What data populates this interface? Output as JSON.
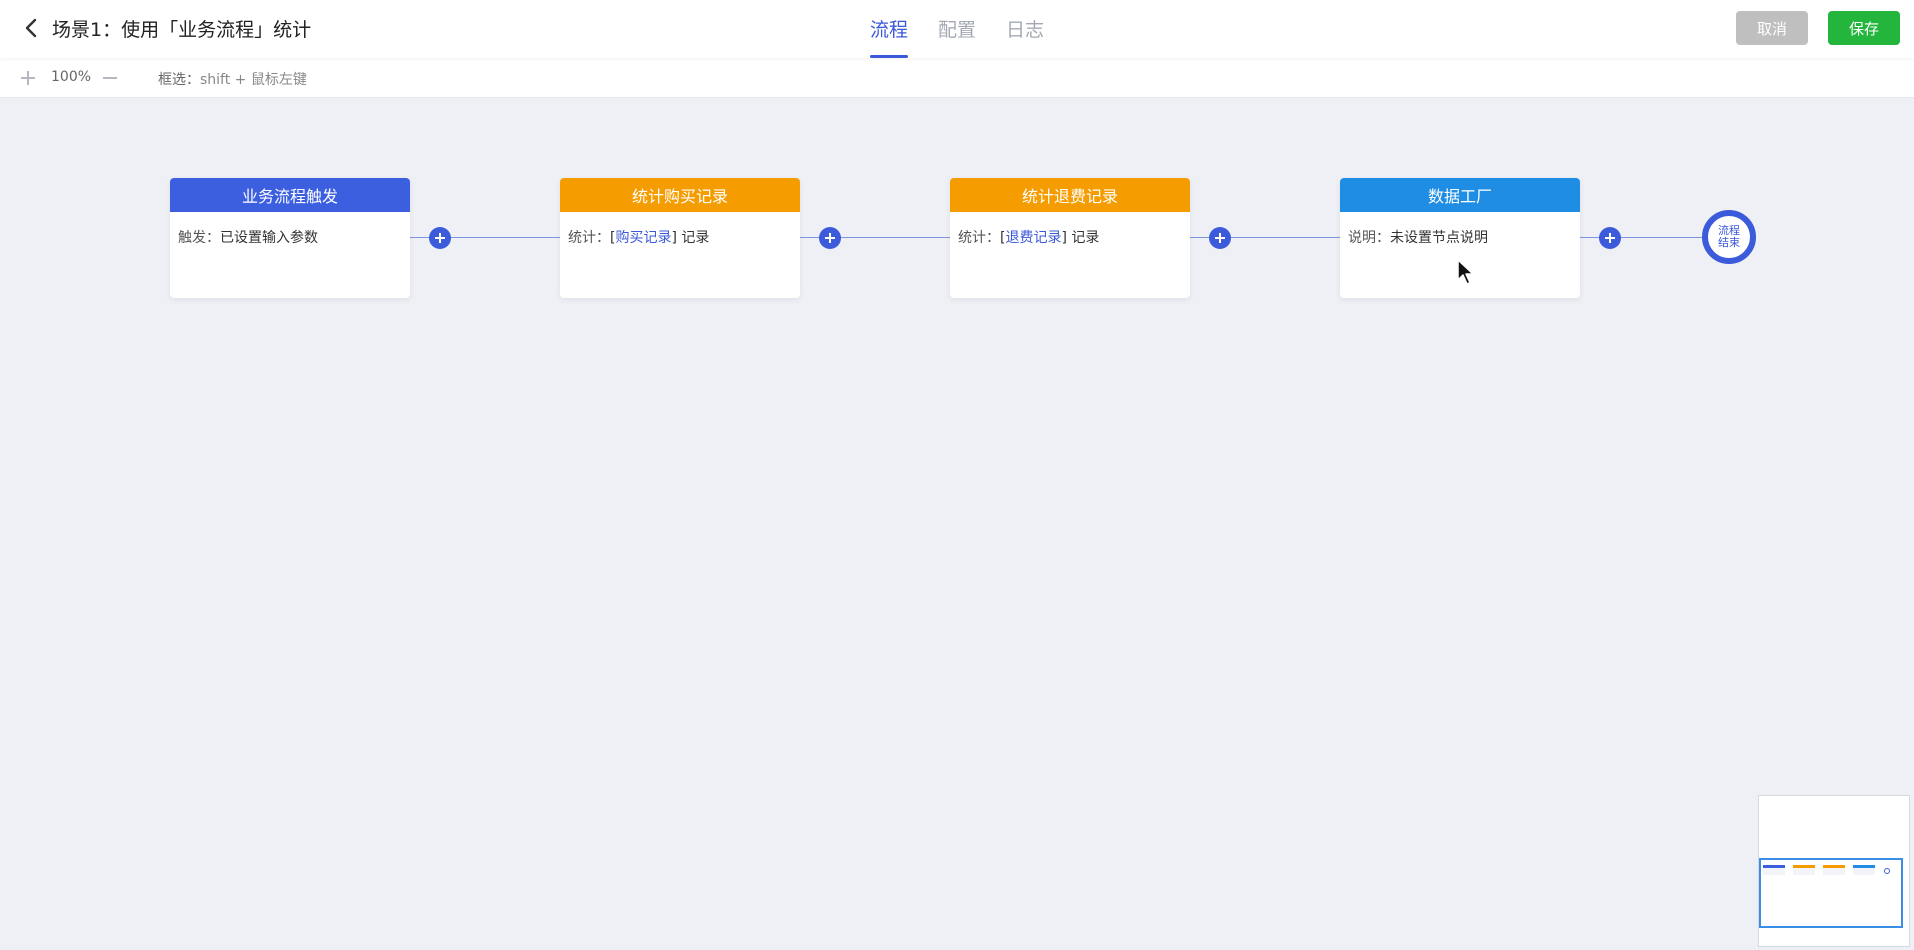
{
  "header": {
    "title": "场景1：使用「业务流程」统计",
    "tabs": [
      {
        "label": "流程",
        "active": true
      },
      {
        "label": "配置",
        "active": false
      },
      {
        "label": "日志",
        "active": false
      }
    ],
    "cancel_label": "取消",
    "save_label": "保存"
  },
  "toolbar": {
    "zoom_level": "100%",
    "select_hint_label": "框选：",
    "select_hint_keys": "shift + 鼠标左键"
  },
  "flow": {
    "nodes": [
      {
        "title": "业务流程触发",
        "color": "#3c5fe0",
        "label": "触发：",
        "before": "",
        "link": "",
        "after": "已设置输入参数"
      },
      {
        "title": "统计购买记录",
        "color": "#f59c00",
        "label": "统计：",
        "before": "[",
        "link": "购买记录",
        "after": "] 记录"
      },
      {
        "title": "统计退费记录",
        "color": "#f59c00",
        "label": "统计：",
        "before": "[",
        "link": "退费记录",
        "after": "] 记录"
      },
      {
        "title": "数据工厂",
        "color": "#1f8de4",
        "label": "说明：",
        "before": "",
        "link": "",
        "after": "未设置节点说明"
      }
    ],
    "end_label_line1": "流程",
    "end_label_line2": "结束"
  },
  "colors": {
    "primary": "#3b59d9",
    "save": "#24b53d",
    "cancel": "#bfbfbf"
  }
}
